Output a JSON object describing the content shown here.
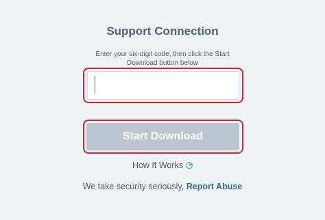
{
  "page": {
    "title": "Support Connection",
    "instructions": "Enter your six-digit code, then click the Start Download button below"
  },
  "code_input": {
    "value": "",
    "placeholder": ""
  },
  "start_button": {
    "label": "Start Download"
  },
  "how_it_works": {
    "label": "How It Works",
    "icon": "chevron-down-circle-icon"
  },
  "security": {
    "text": "We take security seriously,",
    "link_label": "Report Abuse"
  },
  "colors": {
    "background": "#f0f3f6",
    "title": "#4a6682",
    "button_disabled": "#bcc6d0",
    "highlight": "#d9232e",
    "link": "#2f6f9e",
    "icon_accent": "#35a3d6"
  }
}
